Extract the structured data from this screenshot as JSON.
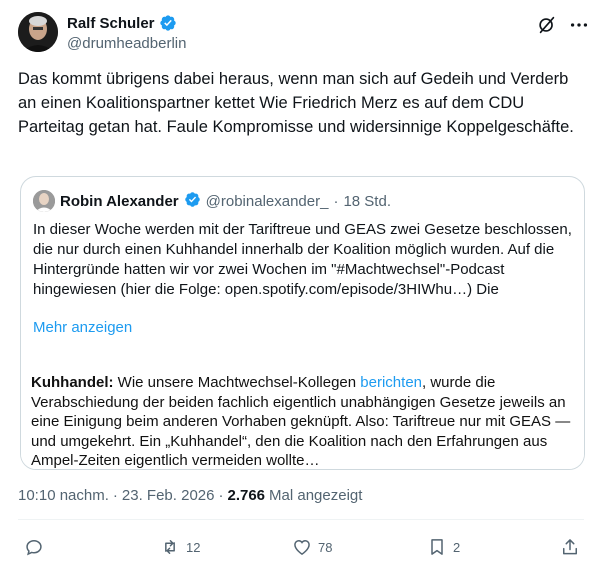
{
  "author": {
    "name": "Ralf Schuler",
    "handle": "@drumheadberlin"
  },
  "tweet": {
    "text": "Das kommt übrigens dabei heraus, wenn man sich auf Gedeih und Verderb an einen Koalitionspartner kettet Wie Friedrich Merz es auf dem CDU Parteitag getan hat. Faule Kompromisse und widersinnige Koppelgeschäfte."
  },
  "quote": {
    "name": "Robin Alexander",
    "handle": "@robinalexander_",
    "separator": "·",
    "time": "18 Std.",
    "text": "In dieser Woche werden mit der Tariftreue und GEAS zwei Gesetze beschlossen, die nur durch einen Kuhhandel innerhalb der Koalition möglich wurden. Auf die Hintergründe hatten wir vor zwei Wochen im \"#Machtwechsel\"-Podcast hingewiesen (hier die Folge: open.spotify.com/episode/3HIWhu…) Die",
    "show_more": "Mehr anzeigen",
    "image": {
      "bold_lead": "Kuhhandel:",
      "part1": " Wie unsere Machtwechsel-Kollegen ",
      "link": "berichten",
      "part2": ", wurde die Verabschiedung der beiden fachlich eigentlich unabhängigen Gesetze jeweils an eine Einigung beim anderen Vorhaben geknüpft. Also: Tariftreue nur mit GEAS — und umgekehrt. Ein „Kuhhandel“, den die Koalition nach den Erfahrungen aus Ampel-Zeiten eigentlich vermeiden wollte…"
    }
  },
  "meta": {
    "time": "10:10 nachm.",
    "sep": "·",
    "date": "23. Feb. 2026",
    "sep2": "·",
    "views": "2.766",
    "views_label": "Mal angezeigt"
  },
  "actions": {
    "reply_count": "",
    "retweet_count": "12",
    "like_count": "78",
    "bookmark_count": "2"
  },
  "colors": {
    "accent": "#1d9bf0",
    "secondary_text": "#536471",
    "verified": "#1d9bf0"
  },
  "icons": [
    "verified-badge-icon",
    "grok-icon",
    "more-icon",
    "reply-icon",
    "retweet-icon",
    "like-icon",
    "bookmark-icon",
    "share-icon"
  ]
}
